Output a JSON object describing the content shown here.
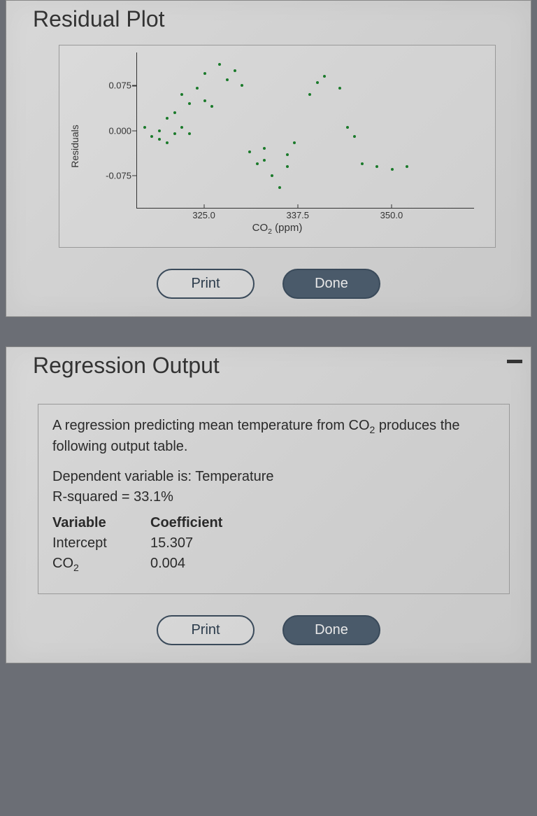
{
  "section1": {
    "title": "Residual Plot",
    "print_label": "Print",
    "done_label": "Done"
  },
  "section2": {
    "title": "Regression Output",
    "intro_prefix": "A regression predicting mean temperature from CO",
    "intro_suffix": " produces the following output table.",
    "dep_line": "Dependent variable is: Temperature",
    "r2_line": "R-squared = 33.1%",
    "table": {
      "head_var": "Variable",
      "head_coef": "Coefficient",
      "row1_var": "Intercept",
      "row1_coef": "15.307",
      "row2_var_prefix": "CO",
      "row2_coef": "0.004"
    },
    "print_label": "Print",
    "done_label": "Done"
  },
  "chart_data": {
    "type": "scatter",
    "title": "",
    "xlabel": "CO₂ (ppm)",
    "ylabel": "Residuals",
    "x_ticks": [
      325.0,
      337.5,
      350.0
    ],
    "y_ticks": [
      -0.075,
      0.0,
      0.075
    ],
    "xlim": [
      316,
      361
    ],
    "ylim": [
      -0.13,
      0.13
    ],
    "points": [
      {
        "x": 317,
        "y": 0.005
      },
      {
        "x": 318,
        "y": -0.01
      },
      {
        "x": 319,
        "y": 0.0
      },
      {
        "x": 319,
        "y": -0.015
      },
      {
        "x": 320,
        "y": 0.02
      },
      {
        "x": 320,
        "y": -0.02
      },
      {
        "x": 321,
        "y": -0.005
      },
      {
        "x": 321,
        "y": 0.03
      },
      {
        "x": 322,
        "y": 0.06
      },
      {
        "x": 322,
        "y": 0.005
      },
      {
        "x": 323,
        "y": 0.045
      },
      {
        "x": 323,
        "y": -0.005
      },
      {
        "x": 324,
        "y": 0.07
      },
      {
        "x": 325,
        "y": 0.095
      },
      {
        "x": 325,
        "y": 0.05
      },
      {
        "x": 326,
        "y": 0.04
      },
      {
        "x": 327,
        "y": 0.11
      },
      {
        "x": 328,
        "y": 0.085
      },
      {
        "x": 329,
        "y": 0.1
      },
      {
        "x": 330,
        "y": 0.075
      },
      {
        "x": 331,
        "y": -0.035
      },
      {
        "x": 332,
        "y": -0.055
      },
      {
        "x": 333,
        "y": -0.03
      },
      {
        "x": 333,
        "y": -0.05
      },
      {
        "x": 334,
        "y": -0.075
      },
      {
        "x": 335,
        "y": -0.095
      },
      {
        "x": 336,
        "y": -0.06
      },
      {
        "x": 336,
        "y": -0.04
      },
      {
        "x": 337,
        "y": -0.02
      },
      {
        "x": 339,
        "y": 0.06
      },
      {
        "x": 340,
        "y": 0.08
      },
      {
        "x": 341,
        "y": 0.09
      },
      {
        "x": 343,
        "y": 0.07
      },
      {
        "x": 344,
        "y": 0.005
      },
      {
        "x": 345,
        "y": -0.01
      },
      {
        "x": 346,
        "y": -0.055
      },
      {
        "x": 348,
        "y": -0.06
      },
      {
        "x": 350,
        "y": -0.065
      },
      {
        "x": 352,
        "y": -0.06
      }
    ]
  }
}
